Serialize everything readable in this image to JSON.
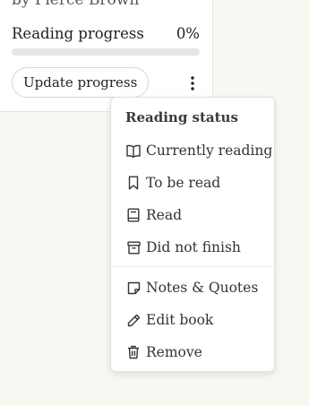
{
  "book": {
    "author_line": "by Pierce Brown"
  },
  "progress": {
    "label": "Reading progress",
    "value_text": "0%",
    "fraction": 0
  },
  "actions": {
    "update_progress": "Update progress",
    "more_icon": "more-vertical-icon"
  },
  "menu": {
    "heading": "Reading status",
    "status_items": [
      {
        "label": "Currently reading",
        "icon": "open-book-icon"
      },
      {
        "label": "To be read",
        "icon": "bookmark-icon"
      },
      {
        "label": "Read",
        "icon": "closed-book-icon"
      },
      {
        "label": "Did not finish",
        "icon": "archive-icon"
      }
    ],
    "other_items": [
      {
        "label": "Notes & Quotes",
        "icon": "note-icon"
      },
      {
        "label": "Edit book",
        "icon": "pencil-icon"
      },
      {
        "label": "Remove",
        "icon": "trash-icon"
      }
    ]
  }
}
